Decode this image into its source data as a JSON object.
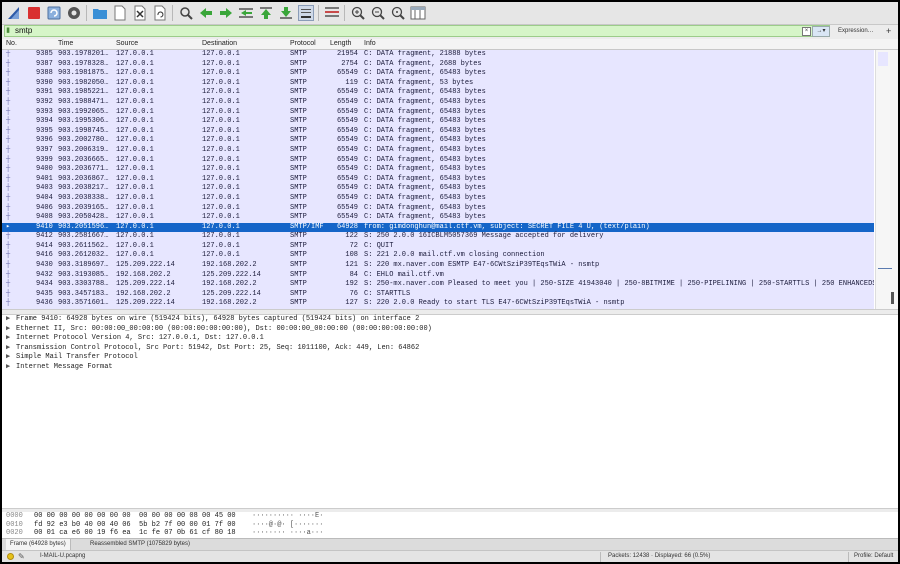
{
  "toolbar": {
    "icons": [
      "shark-fin-icon",
      "stop-icon",
      "restart-icon",
      "options-gear-icon",
      "open-folder-icon",
      "file-icon",
      "close-file-icon",
      "reload-icon",
      "find-icon",
      "back-icon",
      "forward-icon",
      "go-to-packet-icon",
      "first-packet-icon",
      "last-packet-icon",
      "autoscroll-icon",
      "colorize-icon",
      "zoom-in-icon",
      "zoom-out-icon",
      "zoom-reset-icon",
      "resize-columns-icon"
    ]
  },
  "filter": {
    "value": "smtp",
    "expression_label": "Expression…",
    "add_label": "+"
  },
  "packet_list": {
    "columns": [
      "No.",
      "Time",
      "Source",
      "Destination",
      "Protocol",
      "Length",
      "Info"
    ],
    "rows": [
      {
        "no": "9385",
        "time": "903.1978201…",
        "src": "127.0.0.1",
        "dst": "127.0.0.1",
        "proto": "SMTP",
        "len": "21954",
        "info": "C: DATA fragment, 21888 bytes"
      },
      {
        "no": "9387",
        "time": "903.1978328…",
        "src": "127.0.0.1",
        "dst": "127.0.0.1",
        "proto": "SMTP",
        "len": "2754",
        "info": "C: DATA fragment, 2688 bytes"
      },
      {
        "no": "9388",
        "time": "903.1981875…",
        "src": "127.0.0.1",
        "dst": "127.0.0.1",
        "proto": "SMTP",
        "len": "65549",
        "info": "C: DATA fragment, 65483 bytes"
      },
      {
        "no": "9390",
        "time": "903.1982050…",
        "src": "127.0.0.1",
        "dst": "127.0.0.1",
        "proto": "SMTP",
        "len": "119",
        "info": "C: DATA fragment, 53 bytes"
      },
      {
        "no": "9391",
        "time": "903.1985221…",
        "src": "127.0.0.1",
        "dst": "127.0.0.1",
        "proto": "SMTP",
        "len": "65549",
        "info": "C: DATA fragment, 65483 bytes"
      },
      {
        "no": "9392",
        "time": "903.1988471…",
        "src": "127.0.0.1",
        "dst": "127.0.0.1",
        "proto": "SMTP",
        "len": "65549",
        "info": "C: DATA fragment, 65483 bytes"
      },
      {
        "no": "9393",
        "time": "903.1992065…",
        "src": "127.0.0.1",
        "dst": "127.0.0.1",
        "proto": "SMTP",
        "len": "65549",
        "info": "C: DATA fragment, 65483 bytes"
      },
      {
        "no": "9394",
        "time": "903.1995306…",
        "src": "127.0.0.1",
        "dst": "127.0.0.1",
        "proto": "SMTP",
        "len": "65549",
        "info": "C: DATA fragment, 65483 bytes"
      },
      {
        "no": "9395",
        "time": "903.1998745…",
        "src": "127.0.0.1",
        "dst": "127.0.0.1",
        "proto": "SMTP",
        "len": "65549",
        "info": "C: DATA fragment, 65483 bytes"
      },
      {
        "no": "9396",
        "time": "903.2002780…",
        "src": "127.0.0.1",
        "dst": "127.0.0.1",
        "proto": "SMTP",
        "len": "65549",
        "info": "C: DATA fragment, 65483 bytes"
      },
      {
        "no": "9397",
        "time": "903.2006319…",
        "src": "127.0.0.1",
        "dst": "127.0.0.1",
        "proto": "SMTP",
        "len": "65549",
        "info": "C: DATA fragment, 65483 bytes"
      },
      {
        "no": "9399",
        "time": "903.2036665…",
        "src": "127.0.0.1",
        "dst": "127.0.0.1",
        "proto": "SMTP",
        "len": "65549",
        "info": "C: DATA fragment, 65483 bytes"
      },
      {
        "no": "9400",
        "time": "903.2036771…",
        "src": "127.0.0.1",
        "dst": "127.0.0.1",
        "proto": "SMTP",
        "len": "65549",
        "info": "C: DATA fragment, 65483 bytes"
      },
      {
        "no": "9401",
        "time": "903.2036867…",
        "src": "127.0.0.1",
        "dst": "127.0.0.1",
        "proto": "SMTP",
        "len": "65549",
        "info": "C: DATA fragment, 65483 bytes"
      },
      {
        "no": "9403",
        "time": "903.2038217…",
        "src": "127.0.0.1",
        "dst": "127.0.0.1",
        "proto": "SMTP",
        "len": "65549",
        "info": "C: DATA fragment, 65483 bytes"
      },
      {
        "no": "9404",
        "time": "903.2038338…",
        "src": "127.0.0.1",
        "dst": "127.0.0.1",
        "proto": "SMTP",
        "len": "65549",
        "info": "C: DATA fragment, 65483 bytes"
      },
      {
        "no": "9406",
        "time": "903.2039165…",
        "src": "127.0.0.1",
        "dst": "127.0.0.1",
        "proto": "SMTP",
        "len": "65549",
        "info": "C: DATA fragment, 65483 bytes"
      },
      {
        "no": "9408",
        "time": "903.2050428…",
        "src": "127.0.0.1",
        "dst": "127.0.0.1",
        "proto": "SMTP",
        "len": "65549",
        "info": "C: DATA fragment, 65483 bytes"
      },
      {
        "no": "9410",
        "time": "903.2051596…",
        "src": "127.0.0.1",
        "dst": "127.0.0.1",
        "proto": "SMTP/IMF",
        "len": "64928",
        "info": "from: gimdonghun@mail.ctf.vm, subject: SECRET FILE 4 U,  (text/plain)",
        "selected": true
      },
      {
        "no": "9412",
        "time": "903.2581667…",
        "src": "127.0.0.1",
        "dst": "127.0.0.1",
        "proto": "SMTP",
        "len": "122",
        "info": "S: 250 2.0.0 16ICBLM5057369 Message accepted for delivery"
      },
      {
        "no": "9414",
        "time": "903.2611562…",
        "src": "127.0.0.1",
        "dst": "127.0.0.1",
        "proto": "SMTP",
        "len": "72",
        "info": "C: QUIT"
      },
      {
        "no": "9416",
        "time": "903.2612032…",
        "src": "127.0.0.1",
        "dst": "127.0.0.1",
        "proto": "SMTP",
        "len": "108",
        "info": "S: 221 2.0.0 mail.ctf.vm closing connection"
      },
      {
        "no": "9430",
        "time": "903.3189697…",
        "src": "125.209.222.14",
        "dst": "192.168.202.2",
        "proto": "SMTP",
        "len": "121",
        "info": "S: 220 mx.naver.com ESMTP E47-6CWtSziP39TEqsTWiA - nsmtp"
      },
      {
        "no": "9432",
        "time": "903.3193085…",
        "src": "192.168.202.2",
        "dst": "125.209.222.14",
        "proto": "SMTP",
        "len": "84",
        "info": "C: EHLO mail.ctf.vm"
      },
      {
        "no": "9434",
        "time": "903.3303788…",
        "src": "125.209.222.14",
        "dst": "192.168.202.2",
        "proto": "SMTP",
        "len": "192",
        "info": "S: 250-mx.naver.com Pleased to meet you | 250-SIZE 41943040 | 250-8BITMIME | 250-PIPELINING | 250-STARTTLS | 250 ENHANCEDS"
      },
      {
        "no": "9435",
        "time": "903.3457183…",
        "src": "192.168.202.2",
        "dst": "125.209.222.14",
        "proto": "SMTP",
        "len": "76",
        "info": "C: STARTTLS"
      },
      {
        "no": "9436",
        "time": "903.3571601…",
        "src": "125.209.222.14",
        "dst": "192.168.202.2",
        "proto": "SMTP",
        "len": "127",
        "info": "S: 220 2.0.0 Ready to start TLS E47-6CWtSziP39TEqsTWiA - nsmtp"
      }
    ]
  },
  "details": [
    "Frame 9410: 64928 bytes on wire (519424 bits), 64928 bytes captured (519424 bits) on interface 2",
    "Ethernet II, Src: 00:00:00_00:00:00 (00:00:00:00:00:00), Dst: 00:00:00_00:00:00 (00:00:00:00:00:00)",
    "Internet Protocol Version 4, Src: 127.0.0.1, Dst: 127.0.0.1",
    "Transmission Control Protocol, Src Port: 51942, Dst Port: 25, Seq: 1011100, Ack: 449, Len: 64862",
    "Simple Mail Transfer Protocol",
    "Internet Message Format"
  ],
  "bytes": [
    {
      "offset": "0000",
      "hex": "00 00 00 00 00 00 00 00  00 00 00 00 08 00 45 00",
      "ascii": "·········· ····E·"
    },
    {
      "offset": "0010",
      "hex": "fd 92 e3 b0 40 00 40 06  5b b2 7f 00 00 01 7f 00",
      "ascii": "····@·@· [·······"
    },
    {
      "offset": "0020",
      "hex": "00 01 ca e6 00 19 f6 ea  1c fe 07 0b 61 cf 80 18",
      "ascii": "········ ····a···"
    }
  ],
  "byte_tabs": [
    "Frame (64928 bytes)",
    "Reassembled SMTP (1075829 bytes)"
  ],
  "status": {
    "file": "I-MAIL-U.pcapng",
    "packets": "Packets: 12438 · Displayed: 66 (0.5%)",
    "profile": "Profile: Default"
  }
}
